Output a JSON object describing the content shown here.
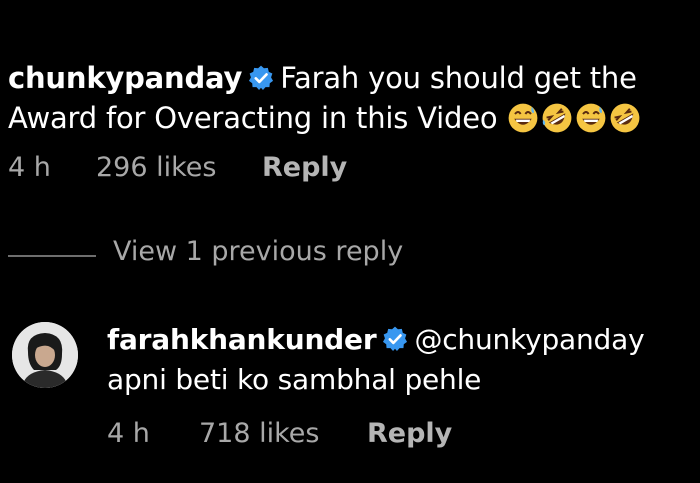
{
  "main_comment": {
    "username": "chunkypanday",
    "text_line1": "Farah you should get the",
    "text_line2": "Award for Overacting in this Video",
    "emojis": [
      "grinning-sweat-emoji",
      "rofl-emoji",
      "grinning-sweat-emoji",
      "rofl-emoji"
    ],
    "time": "4 h",
    "likes": "296 likes",
    "reply_label": "Reply"
  },
  "view_previous": {
    "label": "View 1 previous reply"
  },
  "reply_comment": {
    "username": "farahkhankunder",
    "mention": "@chunkypanday",
    "text": "apni beti ko sambhal pehle",
    "time": "4 h",
    "likes": "718 likes",
    "reply_label": "Reply"
  },
  "colors": {
    "background": "#000000",
    "text": "#ffffff",
    "meta": "#a8a8a8",
    "verified_badge": "#3897f0"
  }
}
